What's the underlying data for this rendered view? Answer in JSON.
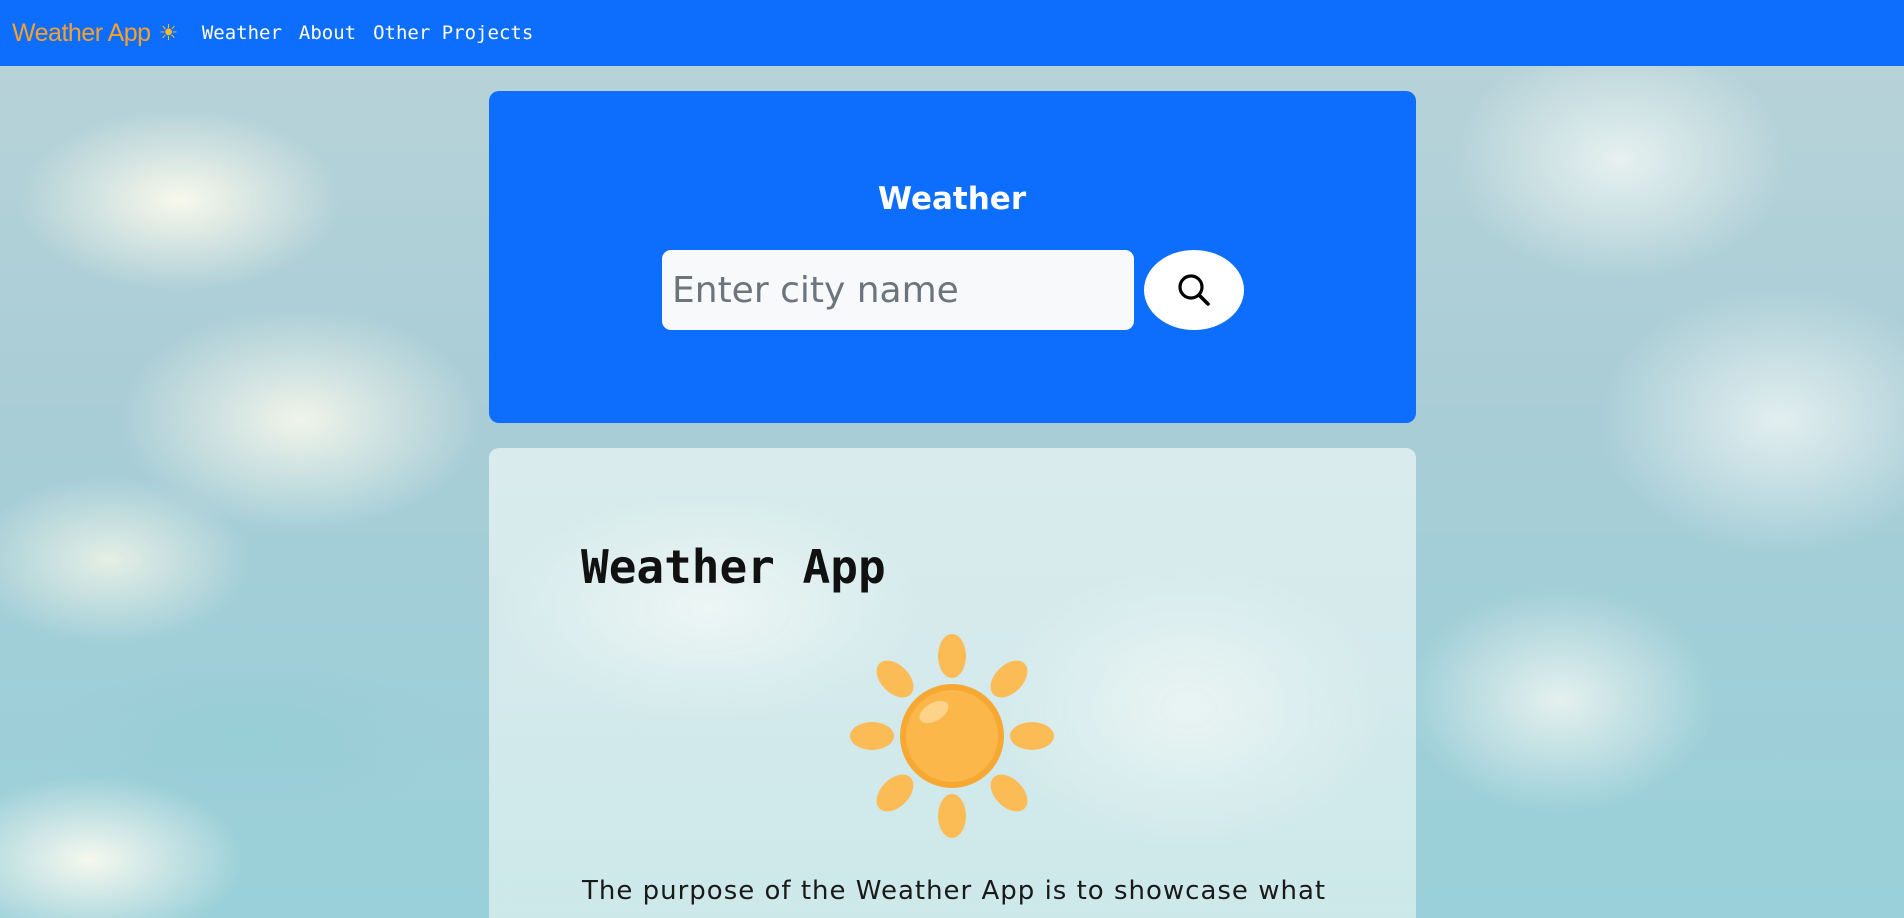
{
  "navbar": {
    "brand": "Weather App",
    "brand_icon": "sun-icon",
    "links": [
      "Weather",
      "About",
      "Other Projects"
    ],
    "brand_color": "#f7a12d",
    "background_color": "#0d6efd"
  },
  "search": {
    "title": "Weather",
    "placeholder": "Enter city name",
    "value": "",
    "button_icon": "magnifier-icon",
    "card_color": "#0d6efd"
  },
  "about": {
    "title": "Weather App",
    "image": "sun-illustration",
    "text": "The purpose of the Weather App is to showcase what",
    "sun_color": "#fbb040"
  }
}
